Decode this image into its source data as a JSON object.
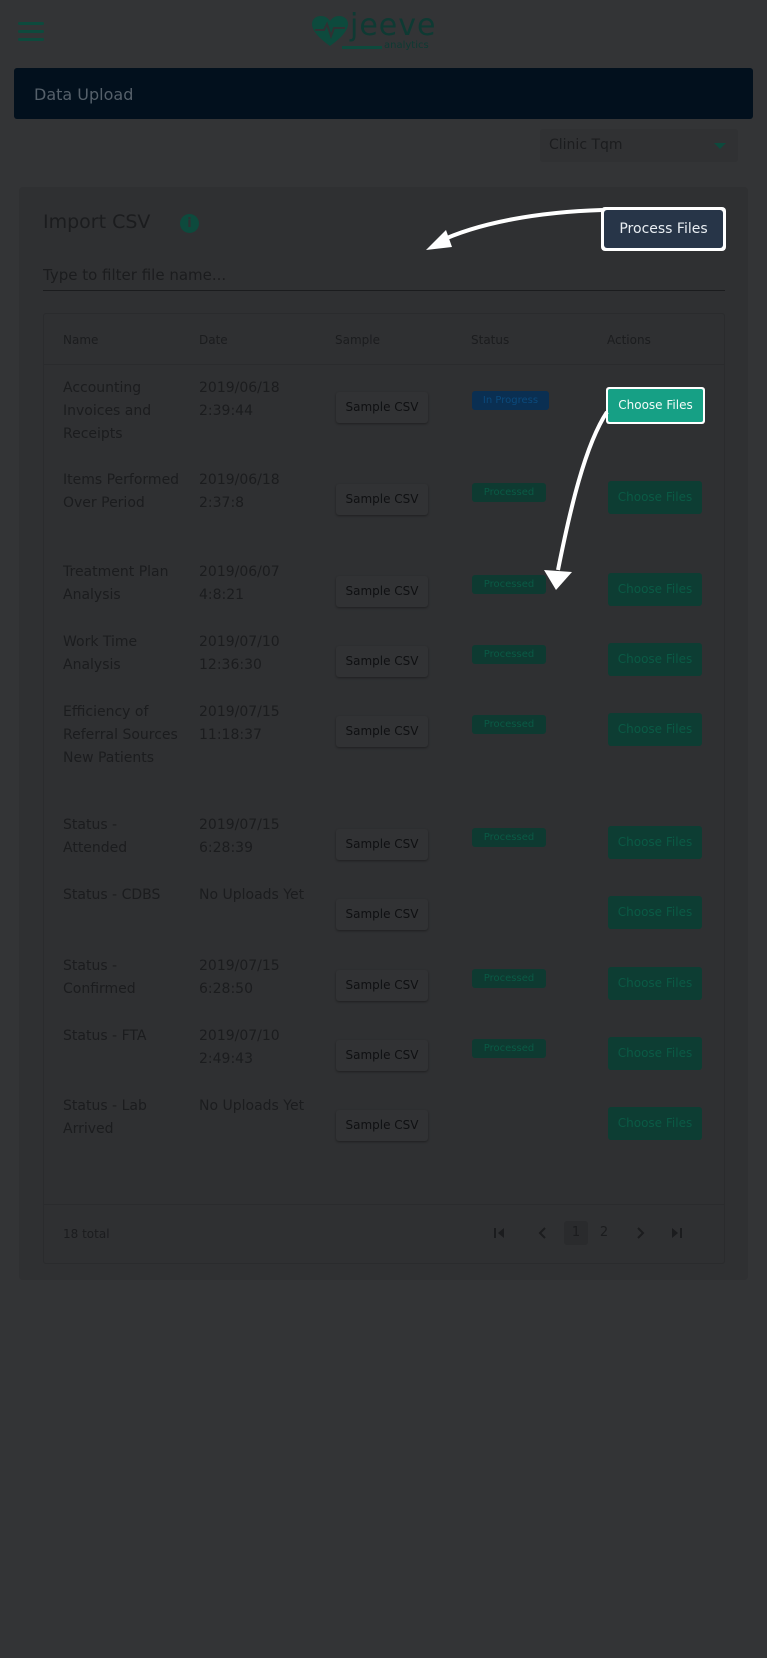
{
  "brand": {
    "name": "jeeve",
    "tagline": "analytics"
  },
  "header": {
    "page_title": "Data Upload"
  },
  "clinic_select": {
    "value": "Clinic Tqm"
  },
  "card": {
    "title": "Import CSV",
    "process_button": "Process Files",
    "filter_placeholder": "Type to filter file name..."
  },
  "table": {
    "columns": [
      "Name",
      "Date",
      "Sample",
      "Status",
      "Actions"
    ],
    "sample_label": "Sample CSV",
    "action_label": "Choose Files",
    "rows": [
      {
        "name": "Accounting Invoices and Receipts",
        "date": "2019/06/18 2:39:44",
        "status": "In Progress"
      },
      {
        "name": "Items Performed Over Period",
        "date": "2019/06/18 2:37:8",
        "status": "Processed"
      },
      {
        "name": "Treatment Plan Analysis",
        "date": "2019/06/07 4:8:21",
        "status": "Processed"
      },
      {
        "name": "Work Time Analysis",
        "date": "2019/07/10 12:36:30",
        "status": "Processed"
      },
      {
        "name": "Efficiency of Referral Sources New Patients",
        "date": "2019/07/15 11:18:37",
        "status": "Processed"
      },
      {
        "name": "Status - Attended",
        "date": "2019/07/15 6:28:39",
        "status": "Processed"
      },
      {
        "name": "Status - CDBS",
        "date": "No Uploads Yet",
        "status": ""
      },
      {
        "name": "Status - Confirmed",
        "date": "2019/07/15 6:28:50",
        "status": "Processed"
      },
      {
        "name": "Status - FTA",
        "date": "2019/07/10 2:49:43",
        "status": "Processed"
      },
      {
        "name": "Status - Lab Arrived",
        "date": "No Uploads Yet",
        "status": ""
      }
    ]
  },
  "pagination": {
    "total": "18 total",
    "pages": [
      "1",
      "2"
    ],
    "first_icon": "first-page-icon",
    "prev_icon": "chevron-left-icon",
    "next_icon": "chevron-right-icon",
    "last_icon": "last-page-icon"
  }
}
